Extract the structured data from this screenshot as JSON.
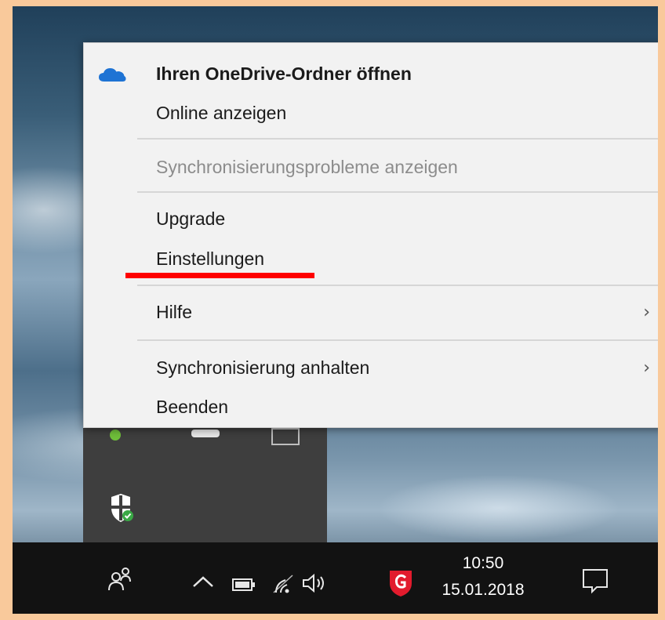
{
  "menu": {
    "items": [
      {
        "name": "menu-item-open-onedrive-folder",
        "label": "Ihren OneDrive-Ordner öffnen",
        "bold": true
      },
      {
        "name": "menu-item-view-online",
        "label": "Online anzeigen"
      },
      {
        "name": "menu-item-sync-problems",
        "label": "Synchronisierungsprobleme anzeigen",
        "disabled": true
      },
      {
        "name": "menu-item-upgrade",
        "label": "Upgrade"
      },
      {
        "name": "menu-item-settings",
        "label": "Einstellungen"
      },
      {
        "name": "menu-item-help",
        "label": "Hilfe",
        "submenu": true
      },
      {
        "name": "menu-item-pause-sync",
        "label": "Synchronisierung anhalten",
        "submenu": true
      },
      {
        "name": "menu-item-exit",
        "label": "Beenden"
      }
    ],
    "chevron": "›",
    "icon": "onedrive-cloud-icon",
    "highlight_color": "#ff0000"
  },
  "taskbar": {
    "time": "10:50",
    "date": "15.01.2018",
    "icons": [
      "people-icon",
      "chevron-up-icon",
      "battery-icon",
      "wifi-icon",
      "volume-icon",
      "gdata-antivirus-icon",
      "action-center-icon"
    ]
  },
  "tray_overflow": {
    "icons": [
      "green-status-icon",
      "usb-drive-icon",
      "keyboard-icon",
      "windows-defender-icon"
    ]
  }
}
